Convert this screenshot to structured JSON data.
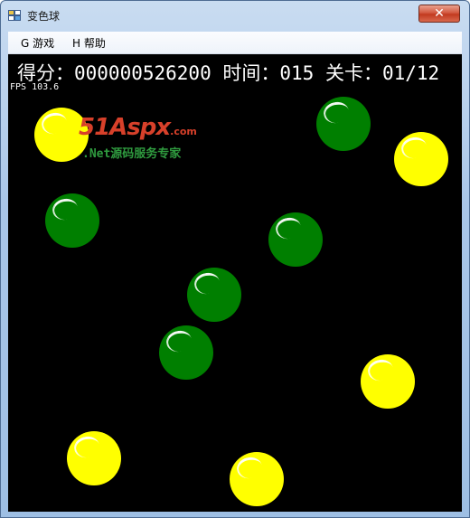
{
  "window": {
    "title": "变色球",
    "close_symbol": "✕",
    "app_icon": "app-window-icon"
  },
  "menu": {
    "items": [
      {
        "label": "G 游戏"
      },
      {
        "label": "H 帮助"
      }
    ]
  },
  "hud": {
    "score_label": "得分：",
    "score": "000000526200",
    "time_label": "时间：",
    "time": "015",
    "level_label": "关卡：",
    "level": "01/12",
    "fps": "FPS 103.6"
  },
  "watermark": {
    "logo": "51Aspx",
    "domain": ".com",
    "subtitle": ".Net源码服务专家"
  },
  "colors": {
    "background": "#000000",
    "yellow_ball": "#ffff00",
    "green_ball": "#007f00",
    "hud_text": "#ffffff"
  },
  "balls": [
    {
      "color": "yellow"
    },
    {
      "color": "green"
    },
    {
      "color": "yellow"
    },
    {
      "color": "green"
    },
    {
      "color": "green"
    },
    {
      "color": "green"
    },
    {
      "color": "green"
    },
    {
      "color": "yellow"
    },
    {
      "color": "yellow"
    },
    {
      "color": "yellow"
    }
  ]
}
